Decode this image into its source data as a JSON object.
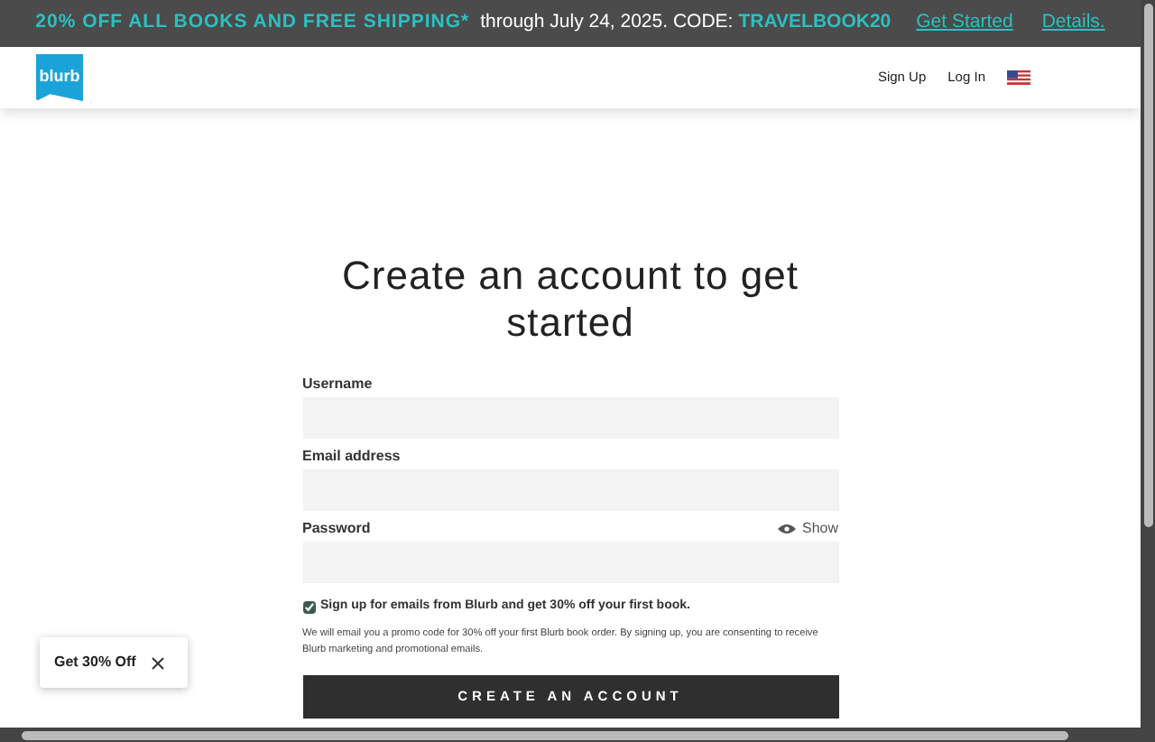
{
  "promo_banner": {
    "headline": "20% OFF ALL BOOKS AND FREE SHIPPING*",
    "terms": "through July 24, 2025. CODE:",
    "code": "TRAVELBOOK20",
    "links": [
      "Get Started",
      "Details."
    ]
  },
  "header": {
    "logo": "blurb",
    "nav": [
      "Sign Up",
      "Log In"
    ]
  },
  "form": {
    "title": "Create an account to get started",
    "fields": [
      {
        "label": "Username"
      },
      {
        "label": "Email address"
      },
      {
        "label": "Password",
        "toggle": "Show"
      }
    ],
    "newsletter": {
      "label": "Sign up for emails from Blurb and get 30% off your first book.",
      "checked": true
    },
    "disclaimer": "We will email you a promo code for 30% off your first Blurb book order. By signing up, you are consenting to receive Blurb marketing and promotional emails.",
    "submit": "CREATE AN ACCOUNT"
  },
  "offer_popup": {
    "label": "Get 30% Off"
  }
}
